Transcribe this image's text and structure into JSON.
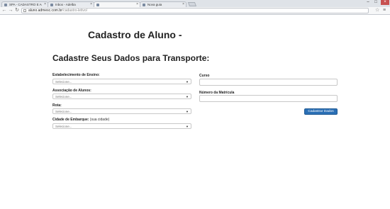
{
  "browser": {
    "tabs": [
      {
        "label": "SPA - CADASTRO E ACE"
      },
      {
        "label": "Inbox - Adelba"
      },
      {
        "label": ""
      },
      {
        "label": "Nova guia"
      }
    ],
    "url_host": "aluno.admesc.com.br",
    "url_path": "/cadastro-letivo/",
    "icons": {
      "back": "back-arrow-icon",
      "forward": "forward-arrow-icon",
      "reload": "reload-icon",
      "star": "star-icon",
      "menu": "hamburger-menu-icon"
    }
  },
  "page": {
    "title": "Cadastro de Aluno -",
    "subtitle": "Cadastre Seus Dados para Transporte:"
  },
  "form": {
    "left": [
      {
        "label": "Estabelecimento de Ensino:",
        "value": "Selecione..."
      },
      {
        "label": "Associação de Alunos:",
        "value": "Selecione..."
      },
      {
        "label": "Rota:",
        "value": "Selecione..."
      },
      {
        "label": "Cidade de Embarque:",
        "hint": "(sua cidade)",
        "value": "Selecione..."
      }
    ],
    "right": [
      {
        "label": "Curso",
        "value": ""
      },
      {
        "label": "Número da Matrícula",
        "value": ""
      }
    ],
    "submit_label": "Cadastrar Dados"
  },
  "colors": {
    "primary_button": "#2a6fb5"
  }
}
